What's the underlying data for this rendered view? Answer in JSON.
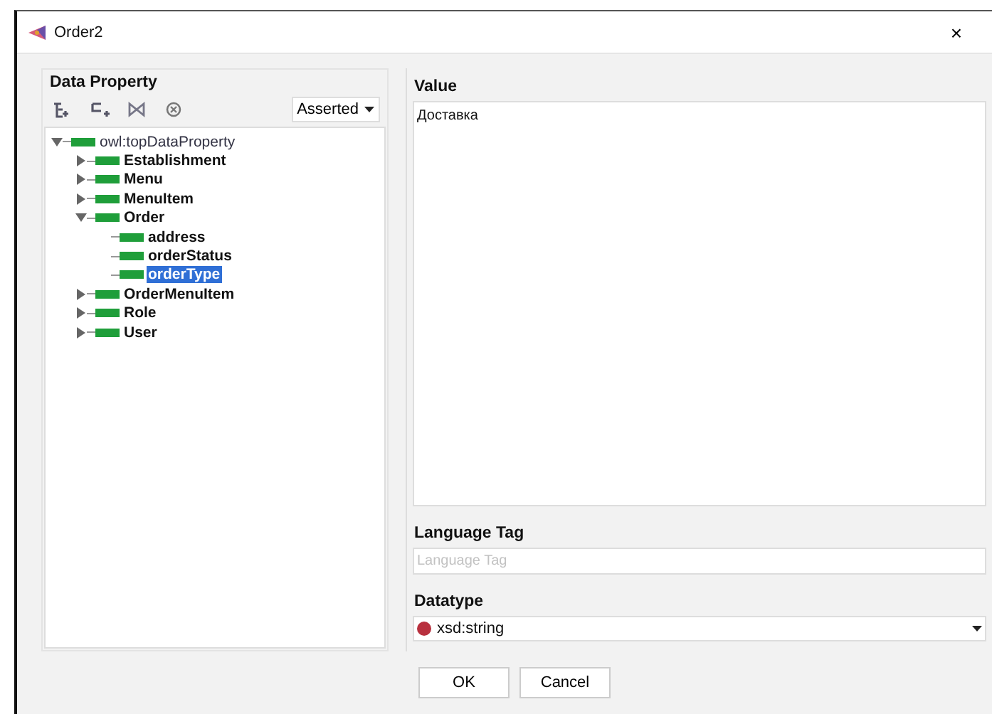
{
  "window": {
    "title": "Order2",
    "close": "×"
  },
  "data_property": {
    "title": "Data Property",
    "dropdown": "Asserted",
    "tree": [
      {
        "label": "owl:topDataProperty",
        "expanded": true,
        "selected": false,
        "children": [
          {
            "label": "Establishment",
            "expanded": false,
            "selected": false
          },
          {
            "label": "Menu",
            "expanded": false,
            "selected": false
          },
          {
            "label": "MenuItem",
            "expanded": false,
            "selected": false
          },
          {
            "label": "Order",
            "expanded": true,
            "selected": false,
            "children": [
              {
                "label": "address",
                "selected": false
              },
              {
                "label": "orderStatus",
                "selected": false
              },
              {
                "label": "orderType",
                "selected": true
              }
            ]
          },
          {
            "label": "OrderMenuItem",
            "expanded": false,
            "selected": false
          },
          {
            "label": "Role",
            "expanded": false,
            "selected": false
          },
          {
            "label": "User",
            "expanded": false,
            "selected": false
          }
        ]
      }
    ]
  },
  "value": {
    "label": "Value",
    "text": "Доставка"
  },
  "language_tag": {
    "label": "Language Tag",
    "placeholder": "Language Tag"
  },
  "datatype": {
    "label": "Datatype",
    "value": "xsd:string"
  },
  "buttons": [
    "OK",
    "Cancel"
  ]
}
